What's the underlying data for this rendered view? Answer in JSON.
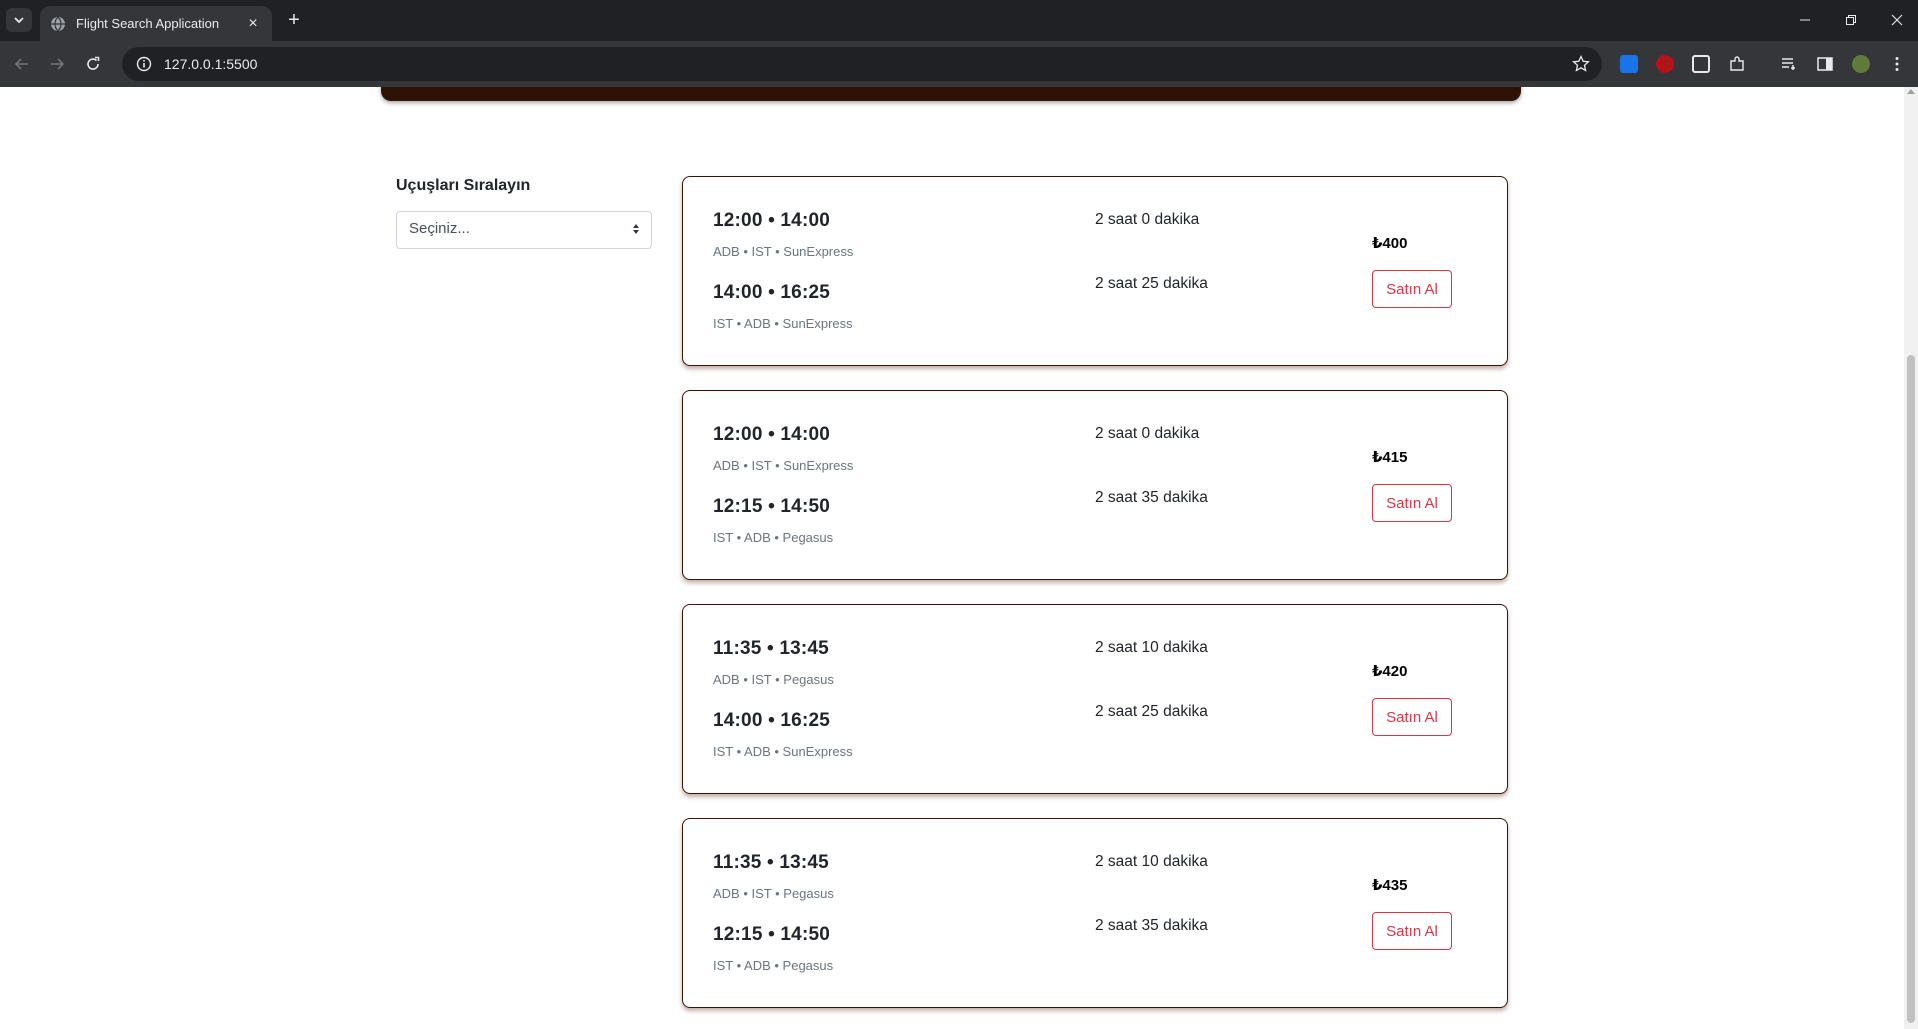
{
  "browser": {
    "tab_title": "Flight Search Application",
    "url": "127.0.0.1:5500"
  },
  "sort": {
    "label": "Uçuşları Sıralayın",
    "selected": "Seçiniz..."
  },
  "flights": [
    {
      "outbound": {
        "time": "12:00 • 14:00",
        "route": "ADB • IST • SunExpress",
        "duration": "2 saat 0 dakika"
      },
      "return": {
        "time": "14:00 • 16:25",
        "route": "IST • ADB • SunExpress",
        "duration": "2 saat 25 dakika"
      },
      "price": "₺400",
      "buy_label": "Satın Al"
    },
    {
      "outbound": {
        "time": "12:00 • 14:00",
        "route": "ADB • IST • SunExpress",
        "duration": "2 saat 0 dakika"
      },
      "return": {
        "time": "12:15 • 14:50",
        "route": "IST • ADB • Pegasus",
        "duration": "2 saat 35 dakika"
      },
      "price": "₺415",
      "buy_label": "Satın Al"
    },
    {
      "outbound": {
        "time": "11:35 • 13:45",
        "route": "ADB • IST • Pegasus",
        "duration": "2 saat 10 dakika"
      },
      "return": {
        "time": "14:00 • 16:25",
        "route": "IST • ADB • SunExpress",
        "duration": "2 saat 25 dakika"
      },
      "price": "₺420",
      "buy_label": "Satın Al"
    },
    {
      "outbound": {
        "time": "11:35 • 13:45",
        "route": "ADB • IST • Pegasus",
        "duration": "2 saat 10 dakika"
      },
      "return": {
        "time": "12:15 • 14:50",
        "route": "IST • ADB • Pegasus",
        "duration": "2 saat 35 dakika"
      },
      "price": "₺435",
      "buy_label": "Satın Al"
    }
  ],
  "colors": {
    "accent_danger": "#dc3545",
    "header_brown": "#2e1206",
    "card_border": "#3a1508"
  }
}
